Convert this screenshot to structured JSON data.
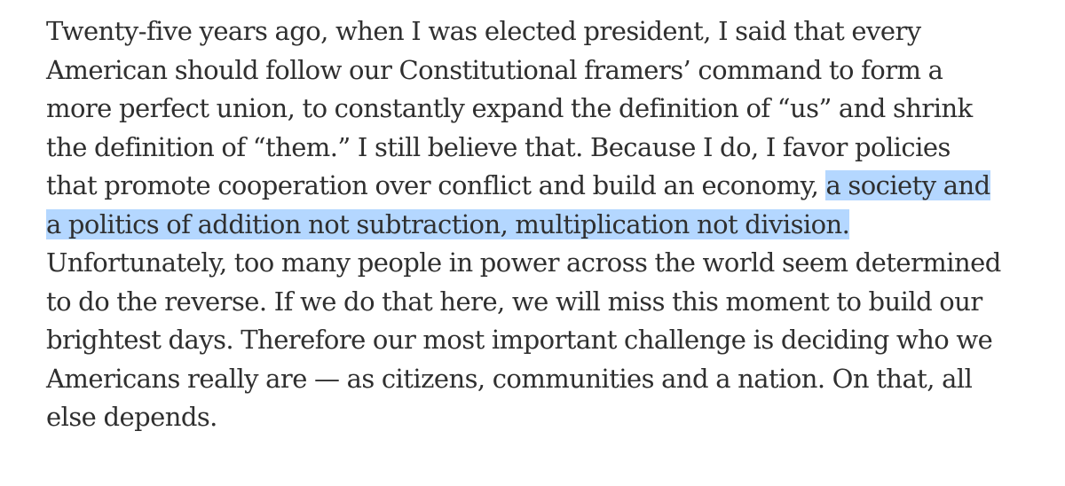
{
  "article": {
    "lines": [
      "Twenty-five years ago, when I was elected president, I said that every",
      "American should follow our Constitutional framers’ command to form a",
      "more perfect union, to constantly expand the definition of “us” and shrink",
      "the definition of “them.” I still believe that. Because I do, I favor policies",
      "that promote cooperation over conflict and build an economy, ",
      "Unfortunately, too many people in power across the world seem determined",
      "to do the reverse. If we do that here, we will miss this moment to build our",
      "brightest days. Therefore our most important challenge is deciding who we",
      "Americans really are — as citizens, communities and a nation. On that, all",
      "else depends."
    ],
    "highlighted": [
      "a society and",
      "a politics of addition not subtraction, multiplication not division."
    ]
  },
  "colors": {
    "text": "#2f2f2f",
    "selection": "#b4d7ff",
    "background": "#ffffff"
  }
}
